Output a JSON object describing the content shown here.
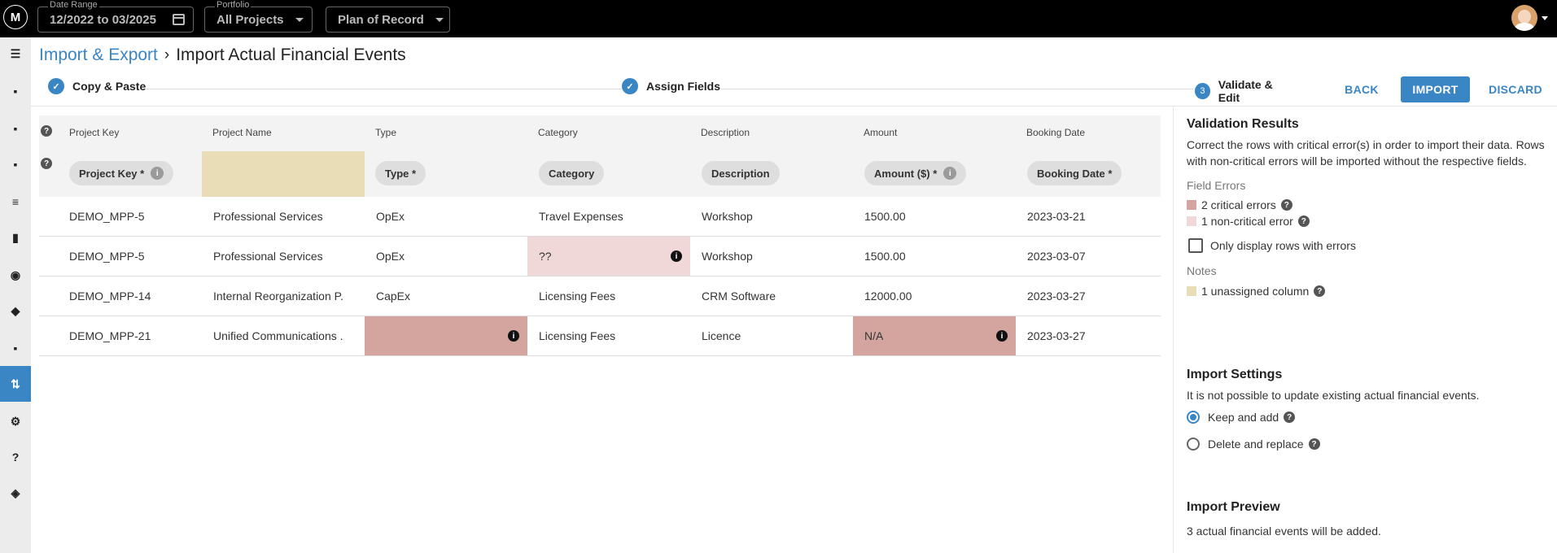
{
  "topbar": {
    "logo_text": "M",
    "date_range": {
      "label": "Date Range",
      "value": "12/2022 to 03/2025"
    },
    "portfolio": {
      "label": "Portfolio",
      "value": "All Projects"
    },
    "plan": {
      "value": "Plan of Record"
    }
  },
  "sidebar": {
    "items": [
      {
        "icon": "menu-icon",
        "glyph": "☰"
      },
      {
        "icon": "person-list-icon",
        "glyph": "▪"
      },
      {
        "icon": "clipboard-icon",
        "glyph": "▪"
      },
      {
        "icon": "people-icon",
        "glyph": "▪"
      },
      {
        "icon": "list-icon",
        "glyph": "≡"
      },
      {
        "icon": "columns-icon",
        "glyph": "▮"
      },
      {
        "icon": "target-icon",
        "glyph": "◉"
      },
      {
        "icon": "diamond-icon",
        "glyph": "◆"
      },
      {
        "icon": "document-icon",
        "glyph": "▪"
      },
      {
        "icon": "import-export-icon",
        "glyph": "⇅"
      },
      {
        "icon": "gear-icon",
        "glyph": "⚙"
      },
      {
        "icon": "help-icon",
        "glyph": "?"
      },
      {
        "icon": "compass-icon",
        "glyph": "◈"
      }
    ],
    "active_index": 9
  },
  "breadcrumb": {
    "parent": "Import & Export",
    "separator": "›",
    "current": "Import Actual Financial Events"
  },
  "steps": [
    {
      "label": "Copy & Paste",
      "marker": "✓"
    },
    {
      "label": "Assign Fields",
      "marker": "✓"
    },
    {
      "label": "Validate & Edit",
      "marker": "3"
    }
  ],
  "actions": {
    "back": "BACK",
    "import": "IMPORT",
    "discard": "DISCARD"
  },
  "table": {
    "help": "?",
    "columns": [
      "Project Key",
      "Project Name",
      "Type",
      "Category",
      "Description",
      "Amount",
      "Booking Date"
    ],
    "field_chips": [
      "Project Key *",
      "",
      "Type *",
      "Category",
      "Description",
      "Amount ($) *",
      "Booking Date *"
    ],
    "info_glyph": "i",
    "rows": [
      [
        "DEMO_MPP-5",
        "Professional Services",
        "OpEx",
        "Travel Expenses",
        "Workshop",
        "1500.00",
        "2023-03-21"
      ],
      [
        "DEMO_MPP-5",
        "Professional Services",
        "OpEx",
        "??",
        "Workshop",
        "1500.00",
        "2023-03-07"
      ],
      [
        "DEMO_MPP-14",
        "Internal Reorganization P...",
        "CapEx",
        "Licensing Fees",
        "CRM Software",
        "12000.00",
        "2023-03-27"
      ],
      [
        "DEMO_MPP-21",
        "Unified Communications ...",
        "",
        "Licensing Fees",
        "Licence",
        "N/A",
        "2023-03-27"
      ]
    ]
  },
  "validation": {
    "title": "Validation Results",
    "description": "Correct the rows with critical error(s) in order to import their data. Rows with non-critical errors will be imported without the respective fields.",
    "field_errors_label": "Field Errors",
    "critical": "2 critical errors",
    "non_critical": "1 non-critical error",
    "only_errors": "Only display rows with errors",
    "notes_label": "Notes",
    "unassigned": "1 unassigned column",
    "colors": {
      "critical": "#d4a49f",
      "non_critical": "#efd8d7",
      "unassigned": "#e8ddb7"
    }
  },
  "settings": {
    "title": "Import Settings",
    "description": "It is not possible to update existing actual financial events.",
    "keep": "Keep and add",
    "delete": "Delete and replace"
  },
  "preview": {
    "title": "Import Preview",
    "text": "3 actual financial events will be added."
  },
  "accent": "#3a85c4"
}
